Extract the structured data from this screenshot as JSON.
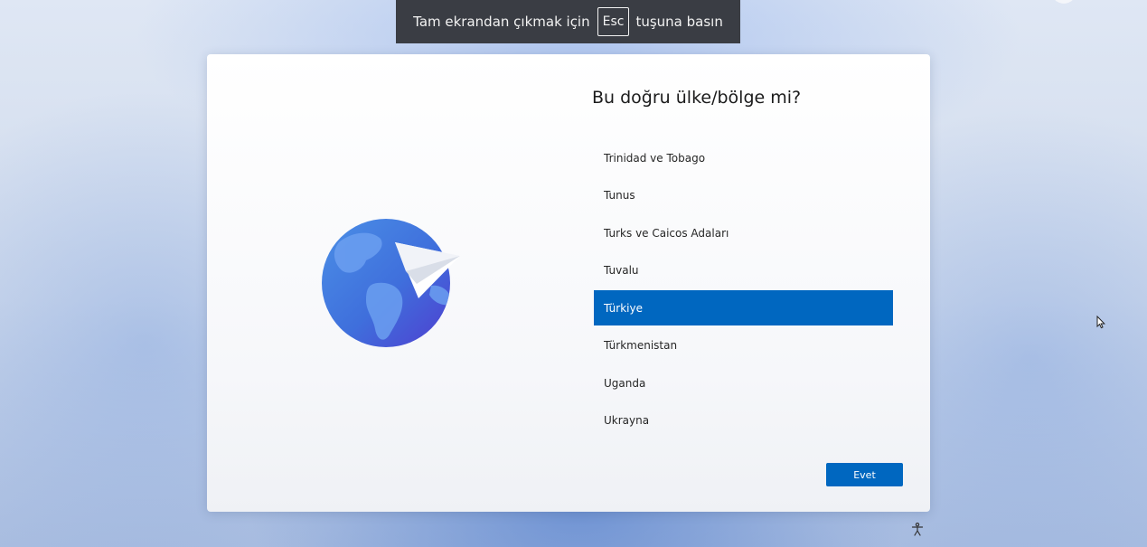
{
  "fullscreen_notice": {
    "before": "Tam ekrandan çıkmak için",
    "key": "Esc",
    "after": "tuşuna basın"
  },
  "oobe": {
    "title": "Bu doğru ülke/bölge mi?",
    "illustration_icon": "globe-paper-plane-icon",
    "countries": [
      {
        "label": "Trinidad ve Tobago",
        "selected": false
      },
      {
        "label": "Tunus",
        "selected": false
      },
      {
        "label": "Turks ve Caicos Adaları",
        "selected": false
      },
      {
        "label": "Tuvalu",
        "selected": false
      },
      {
        "label": "Türkiye",
        "selected": true
      },
      {
        "label": "Türkmenistan",
        "selected": false
      },
      {
        "label": "Uganda",
        "selected": false
      },
      {
        "label": "Ukrayna",
        "selected": false
      }
    ],
    "yes_button_label": "Evet"
  },
  "taskbar": {
    "accessibility_icon": "accessibility-icon"
  },
  "colors": {
    "accent": "#0067c0",
    "banner_bg": "#3a3d44",
    "globe_light": "#4b8fe6",
    "globe_dark": "#4f3ed0"
  }
}
